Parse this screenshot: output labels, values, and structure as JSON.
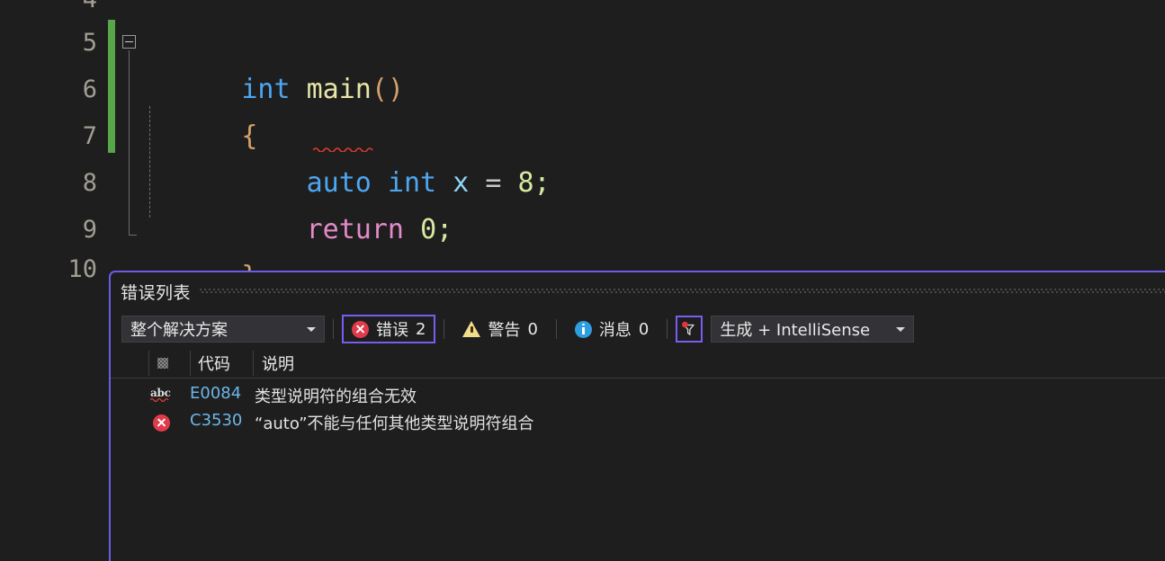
{
  "editor": {
    "line_numbers": [
      "4",
      "5",
      "6",
      "7",
      "8",
      "9",
      "10"
    ],
    "lines": [
      {
        "n": "5",
        "text": "int main()"
      },
      {
        "n": "6",
        "text": "{"
      },
      {
        "n": "7",
        "text": "    auto int x = 8;"
      },
      {
        "n": "8",
        "text": "    return 0;"
      },
      {
        "n": "9",
        "text": "}"
      }
    ],
    "tokens": {
      "kw_int": "int",
      "fn_main": "main",
      "paren_open": "(",
      "paren_close": ")",
      "brace_open": "{",
      "brace_close": "}",
      "kw_auto": "auto",
      "kw_int2": "int",
      "ident_x": "x",
      "op_assign": "=",
      "num_8": "8",
      "semi1": ";",
      "ctl_return": "return",
      "num_0": "0",
      "semi2": ";"
    },
    "colors": {
      "background": "#1e1e1e",
      "line_number": "#a39e93",
      "keyword": "#4ea6f0",
      "function": "#e8e6a8",
      "punctuation": "#d4a06a",
      "identifier": "#8fd3f4",
      "operator": "#c8c8c8",
      "number": "#d7e9a0",
      "control": "#e58ac9",
      "change_bar": "#57a64a",
      "squiggle": "#e03b2f"
    }
  },
  "error_list": {
    "title": "错误列表",
    "scope_filter": {
      "value": "整个解决方案",
      "icon": "chevron-down-icon"
    },
    "severity": [
      {
        "key": "errors",
        "icon": "error-circle-icon",
        "label": "错误",
        "count": "2",
        "selected": true
      },
      {
        "key": "warnings",
        "icon": "warning-triangle-icon",
        "label": "警告",
        "count": "0",
        "selected": false
      },
      {
        "key": "messages",
        "icon": "info-circle-icon",
        "label": "消息",
        "count": "0",
        "selected": false
      }
    ],
    "filter_button": {
      "icon": "filter-funnel-icon",
      "active": true
    },
    "build_filter": {
      "value": "生成 + IntelliSense",
      "icon": "chevron-down-icon"
    },
    "columns": [
      {
        "key": "select",
        "label": ""
      },
      {
        "key": "icon",
        "label": ""
      },
      {
        "key": "code",
        "label": "代码"
      },
      {
        "key": "desc",
        "label": "说明"
      }
    ],
    "rows": [
      {
        "icon": "intellisense-abc-icon",
        "code": "E0084",
        "description": "类型说明符的组合无效"
      },
      {
        "icon": "error-circle-icon",
        "code": "C3530",
        "description": "“auto”不能与任何其他类型说明符组合"
      }
    ],
    "colors": {
      "panel_border": "#6b5ce7",
      "selection_border": "#7a5cf0",
      "error_red": "#e03b4b",
      "warning_yellow": "#f3dd8c",
      "info_blue": "#2f9ee0",
      "code_link": "#6cb6e8",
      "combo_background": "#333337"
    }
  }
}
